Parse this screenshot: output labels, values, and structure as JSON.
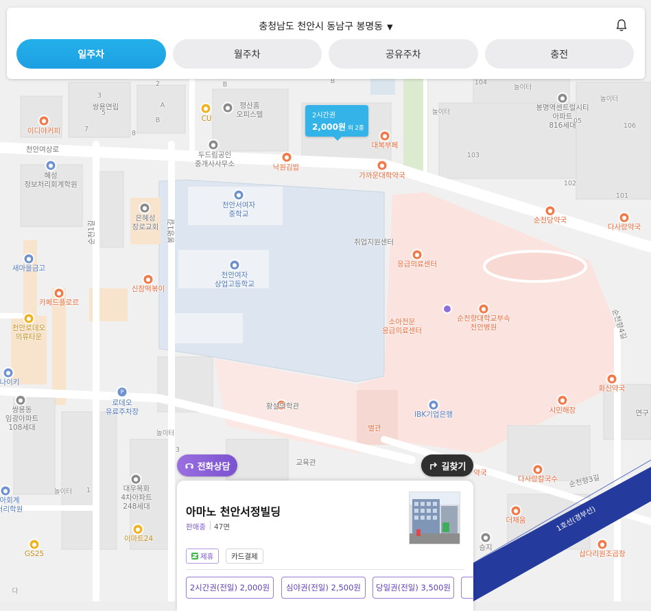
{
  "header": {
    "location": "충청남도 천안시 동남구 봉명동",
    "tabs": [
      {
        "label": "일주차",
        "active": true
      },
      {
        "label": "월주차",
        "active": false
      },
      {
        "label": "공유주차",
        "active": false
      },
      {
        "label": "충전",
        "active": false
      }
    ]
  },
  "map": {
    "labels": {
      "ssangyong": "쌍용연립",
      "idiya": "이디야커피",
      "cu": "CU",
      "pyeongsan": "평산홈\n오피스텔",
      "dudream": "두드림공인\n중개사사무소",
      "nakwon": "낙원김밥",
      "daebuk": "대복부페",
      "gakkaun": "가까운대학약국",
      "hyeseong": "혜성\n정보처리회계학원",
      "cheonanyeosangro": "천안여상로",
      "eunhyeseong": "은혜성\n장로교회",
      "girls_middle": "천안서여자\n중학교",
      "girls_high": "천안여자\n상업고등학교",
      "job_center": "취업지원센터",
      "emergency": "응급의료센터",
      "child_emergency": "소아전문\n응급의료센터",
      "hospital": "순천향대학교부속\n천안병원",
      "saemaeul": "새마을금고",
      "cafe_floral": "카페드플로르",
      "sinchan": "신참떡볶이",
      "cheonanrodeo": "천안로데오\n의류타운",
      "rodeo_parking": "로데오\n유료주차장",
      "hwangseol": "황설의학관",
      "ibk": "IBK기업은행",
      "byeolgwan": "별관",
      "gyoyukgwan": "교육관",
      "ssangyong_apt": "쌍용동\n임광아파트\n108세대",
      "daewoo_apt": "대우목화\n4차아파트\n248세대",
      "emart24": "이마트24",
      "gs25": "GS25",
      "nolter1": "놀이터",
      "nolter2": "놀이터",
      "nolter3": "놀이터",
      "nolter4": "놀이터",
      "nolter5": "놀이터",
      "bongmyeong_apt": "봉명역센트럴시티\n아파트\n816세대",
      "suncheondang": "순천당약국",
      "dasarang": "다사랑약국",
      "hwasin": "화신약국",
      "simin": "시민해장",
      "dasarang_kal": "다사랑칼국수",
      "deochaeum": "더채움",
      "sapdari": "삽다리원조곱창",
      "seungji": "승지",
      "yak": "약국",
      "naiki": "나이키",
      "hoegye": "아회계\n처리학원",
      "yeongu": "연구",
      "line1": "1호선(경부선)",
      "suncheonhyang3": "순천향3길",
      "suncheonhyang4": "순천향4길",
      "bongmyeong1": "봉명1길",
      "suncheon1": "순천1길",
      "b101": "101",
      "b102": "102",
      "b103": "103",
      "b104": "104",
      "b106": "106",
      "b05": "05",
      "n1": "1",
      "n2": "2",
      "n3": "3",
      "n5": "5",
      "n7": "7",
      "n8": "8",
      "nA": "A",
      "nB": "B",
      "nB2": "B",
      "nB3": "B",
      "n3b": "3",
      "nDa": "다"
    }
  },
  "price_bubble": {
    "ticket": "2시간권",
    "price": "2,000원",
    "extra": "외 2종"
  },
  "buttons": {
    "consult": "전화상담",
    "directions": "길찾기"
  },
  "card": {
    "name": "아마노 천안서정빌딩",
    "status": "판매중",
    "count": "47면",
    "chips": {
      "partner": "제휴",
      "card_payment": "카드결제"
    },
    "tickets": [
      "2시간권(전일) 2,000원",
      "심야권(전일) 2,500원",
      "당일권(전일) 3,500원"
    ]
  },
  "colors": {
    "accent": "#1fa6e6",
    "consult": "#8a5fd9",
    "campus": "#dfe7f1",
    "hospital": "#fbe3df",
    "rail": "#243a9c"
  }
}
